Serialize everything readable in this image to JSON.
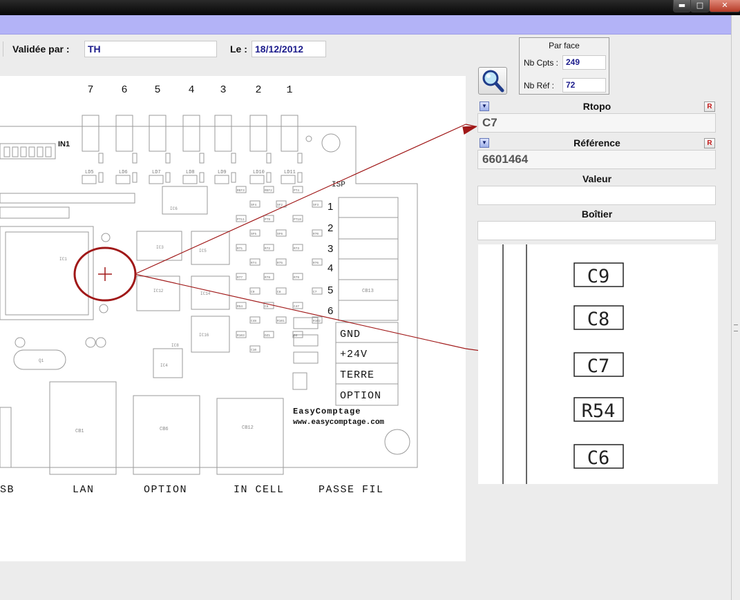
{
  "window": {
    "minimize_glyph": "▬",
    "maximize_glyph": "□",
    "close_glyph": "✕"
  },
  "header": {
    "validated_label": "Validée par :",
    "validated_value": "TH",
    "date_label": "Le :",
    "date_value": "18/12/2012"
  },
  "par_face": {
    "title": "Par face",
    "nb_cpts_label": "Nb Cpts :",
    "nb_cpts_value": "249",
    "nb_ref_label": "Nb Réf :",
    "nb_ref_value": "72"
  },
  "fields": {
    "rtopo_label": "Rtopo",
    "rtopo_value": "C7",
    "reference_label": "Référence",
    "reference_value": "6601464",
    "valeur_label": "Valeur",
    "valeur_value": "",
    "boitier_label": "Boîtier",
    "boitier_value": "",
    "r_button": "R"
  },
  "board": {
    "led_numbers": [
      "7",
      "6",
      "5",
      "4",
      "3",
      "2",
      "1"
    ],
    "leds": [
      "LD5",
      "LD6",
      "LD7",
      "LD8",
      "LD9",
      "LD10",
      "LD11"
    ],
    "in1_label": "IN1",
    "isp_label": "ISP",
    "isp_pins": [
      "1",
      "2",
      "3",
      "4",
      "5",
      "6"
    ],
    "terminal_labels": [
      "GND",
      "+24V",
      "TERRE",
      "OPTION"
    ],
    "brand": "EasyComptage",
    "url": "www.easycomptage.com",
    "bottom_labels": [
      "SB",
      "LAN",
      "OPTION",
      "IN CELL",
      "PASSE FIL"
    ],
    "connectors": [
      "CB1",
      "CB6",
      "CB12",
      "CB13"
    ],
    "ic_labels": [
      "IC1",
      "IC3",
      "IC5",
      "IC6",
      "IC8",
      "IC12",
      "IC14",
      "IC16",
      "IC4",
      "Q1"
    ],
    "small_parts": [
      "REF3",
      "REF2",
      "PT4",
      "SF4",
      "SF2",
      "SF3",
      "PT11",
      "PT9",
      "PT10",
      "SF5",
      "SF6",
      "R70",
      "R71",
      "R72",
      "R73",
      "R74",
      "R75",
      "R76",
      "R77",
      "R78",
      "R79",
      "C9",
      "C8",
      "C7",
      "R54",
      "C6",
      "C47",
      "C48",
      "R101",
      "R102",
      "R103",
      "DZ1",
      "D2",
      "C10"
    ]
  },
  "zoom": {
    "components": [
      "C9",
      "C8",
      "C7",
      "R54",
      "C6"
    ]
  },
  "colors": {
    "accent_blue": "#b3b3f7",
    "value_text": "#1c1c8c",
    "marker_red": "#a01818"
  }
}
